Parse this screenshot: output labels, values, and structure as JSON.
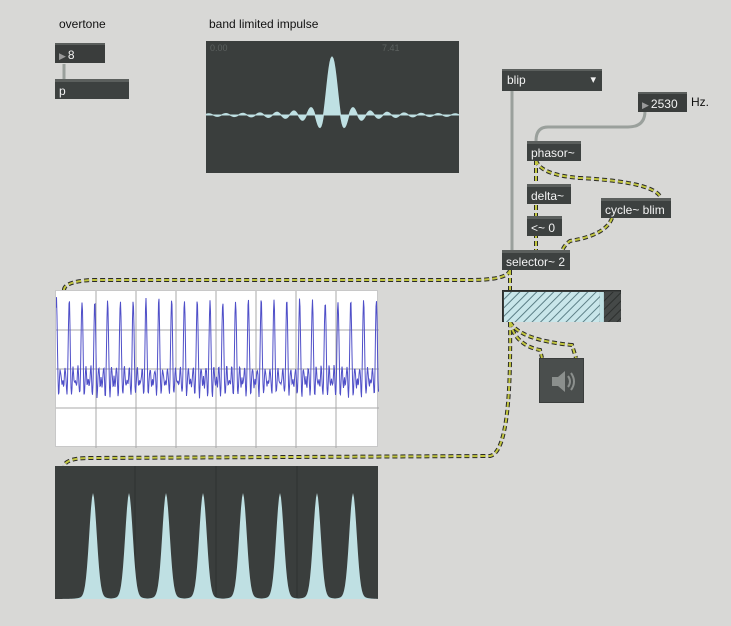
{
  "labels": {
    "overtone": "overtone",
    "band_limited_impulse": "band limited impulse",
    "hz": "Hz."
  },
  "overtone_number": "8",
  "p_object": "p",
  "frequency_number": "2530",
  "waveform_menu": {
    "selected": "blip",
    "chevron": "▾"
  },
  "objects": {
    "phasor": "phasor~",
    "delta": "delta~",
    "lessthan": "<~ 0",
    "cycle": "cycle~ blim",
    "selector": "selector~ 2"
  },
  "impulse_display": {
    "left_value": "0.00",
    "right_value": "7.41"
  },
  "level_meter": {
    "level": 0.82
  },
  "colors": {
    "patch_bg": "#d8d8d6",
    "object_bg": "#3d4140",
    "signal_cord": "#c2c640",
    "scope_wave": "#4f4fc8",
    "impulse_fill": "#bfe0e3"
  },
  "icons": {
    "speaker": "speaker-icon"
  }
}
